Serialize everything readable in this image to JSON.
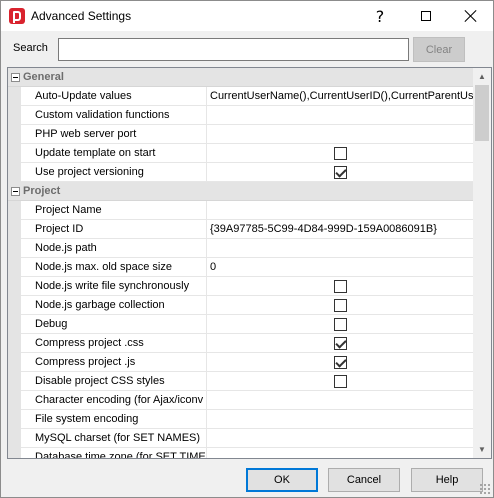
{
  "window": {
    "title": "Advanced Settings",
    "help_glyph": "?"
  },
  "search": {
    "label": "Search",
    "value": "",
    "clear_label": "Clear"
  },
  "grid": {
    "categories": [
      {
        "label": "General",
        "properties": [
          {
            "name": "Auto-Update values",
            "value": "CurrentUserName(),CurrentUserID(),CurrentParentUse",
            "type": "text"
          },
          {
            "name": "Custom validation functions",
            "value": "",
            "type": "text"
          },
          {
            "name": "PHP web server port",
            "value": "",
            "type": "text"
          },
          {
            "name": "Update template on start",
            "checked": false,
            "type": "checkbox"
          },
          {
            "name": "Use project versioning",
            "checked": true,
            "type": "checkbox"
          }
        ]
      },
      {
        "label": "Project",
        "properties": [
          {
            "name": "Project Name",
            "value": "",
            "type": "text"
          },
          {
            "name": "Project ID",
            "value": "{39A97785-5C99-4D84-999D-159A0086091B}",
            "type": "text"
          },
          {
            "name": "Node.js path",
            "value": "",
            "type": "text"
          },
          {
            "name": "Node.js max. old space size",
            "value": "0",
            "type": "text"
          },
          {
            "name": "Node.js write file synchronously",
            "checked": false,
            "type": "checkbox"
          },
          {
            "name": "Node.js garbage collection",
            "checked": false,
            "type": "checkbox"
          },
          {
            "name": "Debug",
            "checked": false,
            "type": "checkbox"
          },
          {
            "name": "Compress project .css",
            "checked": true,
            "type": "checkbox"
          },
          {
            "name": "Compress project .js",
            "checked": true,
            "type": "checkbox"
          },
          {
            "name": "Disable project CSS styles",
            "checked": false,
            "type": "checkbox"
          },
          {
            "name": "Character encoding (for Ajax/iconv",
            "value": "",
            "type": "text"
          },
          {
            "name": "File system encoding",
            "value": "",
            "type": "text"
          },
          {
            "name": "MySQL charset (for SET NAMES)",
            "value": "",
            "type": "text"
          },
          {
            "name": "Database time zone (for SET TIME",
            "value": "",
            "type": "text"
          }
        ]
      }
    ]
  },
  "footer": {
    "ok_label": "OK",
    "cancel_label": "Cancel",
    "help_label": "Help"
  },
  "colors": {
    "accent": "#0078d7",
    "app_icon": "#d9232e"
  }
}
